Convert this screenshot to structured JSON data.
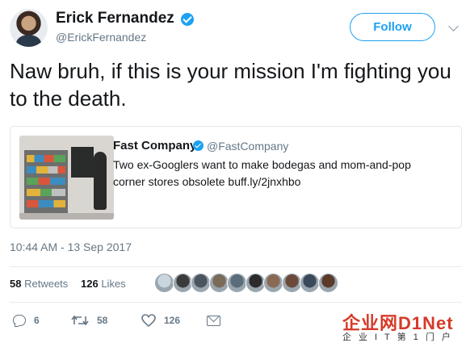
{
  "author": {
    "name": "Erick Fernandez",
    "handle": "@ErickFernandez",
    "verified": true,
    "avatar_icon": "profile-photo"
  },
  "follow_label": "Follow",
  "menu_icon": "chevron-down-icon",
  "tweet_text": "Naw bruh, if this is your mission I'm fighting you to the death.",
  "quoted_tweet": {
    "name": "Fast Company",
    "handle": "@FastCompany",
    "verified": true,
    "text": "Two ex-Googlers want to make bodegas and mom-and-pop corner stores obsolete buff.ly/2jnxhbo",
    "image_icon": "bodega-kiosk-photo"
  },
  "timestamp": "10:44 AM - 13 Sep 2017",
  "stats": {
    "retweets_count": "58",
    "retweets_label": "Retweets",
    "likes_count": "126",
    "likes_label": "Likes"
  },
  "liker_avatars": [
    "#c9d6df",
    "#3b3b3b",
    "#4a5560",
    "#7a6a5a",
    "#5a6e7a",
    "#2c2c2c",
    "#8a6a55",
    "#6b4a3a",
    "#3a4a5a",
    "#5b3a2a"
  ],
  "actions": {
    "reply_count": "6",
    "retweet_count": "58",
    "like_count": "126"
  },
  "watermark": {
    "main": "企业网D1Net",
    "sub": "企业IT第1门户"
  },
  "colors": {
    "accent": "#1da1f2",
    "text_primary": "#14171a",
    "text_secondary": "#657786",
    "border": "#e1e8ed",
    "watermark": "#d63a28"
  }
}
